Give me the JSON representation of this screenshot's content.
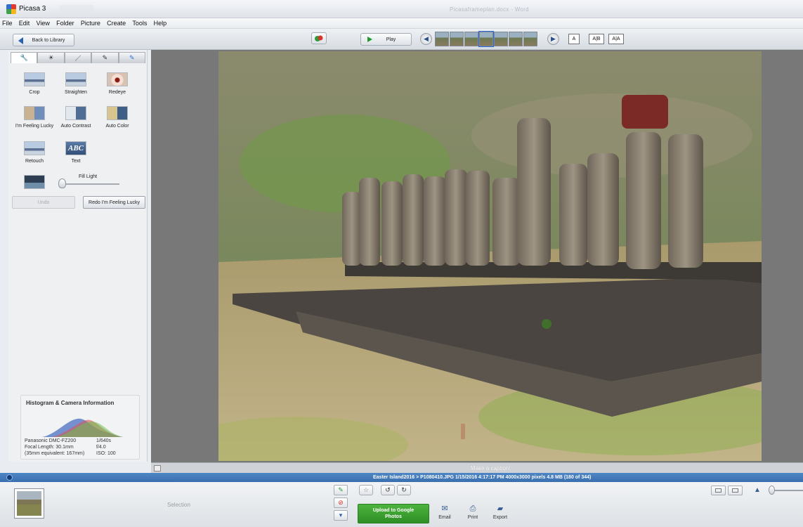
{
  "window": {
    "title": "Picasa 3",
    "document_name": "Picasaframeplan.docx - Word"
  },
  "menu": [
    "File",
    "Edit",
    "View",
    "Folder",
    "Picture",
    "Create",
    "Tools",
    "Help"
  ],
  "toolbar": {
    "back_label": "Back to Library",
    "play_label": "Play",
    "caption_modes": [
      "A",
      "A|B",
      "A|A"
    ]
  },
  "editor": {
    "tabs": [
      "wrench",
      "sun",
      "brush",
      "paint-tool",
      "paint-tool-blue"
    ],
    "fixes": [
      "Crop",
      "Straighten",
      "Redeye",
      "I'm Feeling Lucky",
      "Auto Contrast",
      "Auto Color",
      "Retouch",
      "Text"
    ],
    "text_thumb": "ABC",
    "fill_light_label": "Fill Light",
    "fill_light_value": 0,
    "undo_label": "Undo",
    "redo_label": "Redo I'm Feeling Lucky"
  },
  "histogram": {
    "title": "Histogram & Camera Information",
    "camera": [
      "Panasonic DMC-FZ200",
      "Focal Length: 30.1mm",
      "(35mm equivalent: 167mm)"
    ],
    "settings": [
      "1/640s",
      "f/4.0",
      "ISO: 100"
    ]
  },
  "viewer": {
    "caption_placeholder": "Make a caption!"
  },
  "status": {
    "text": "Easter Island2016 > P1080410.JPG    1/15/2016 4:17:17 PM    4000x3000 pixels    4.8 MB    (180 of 344)"
  },
  "tray": {
    "selection_label": "Selection",
    "upload_label_1": "Upload to Google",
    "upload_label_2": "Photos",
    "actions": [
      "Email",
      "Print",
      "Export"
    ]
  },
  "colors": {
    "accent_blue": "#3a6fae",
    "upload_green": "#3aa330"
  }
}
